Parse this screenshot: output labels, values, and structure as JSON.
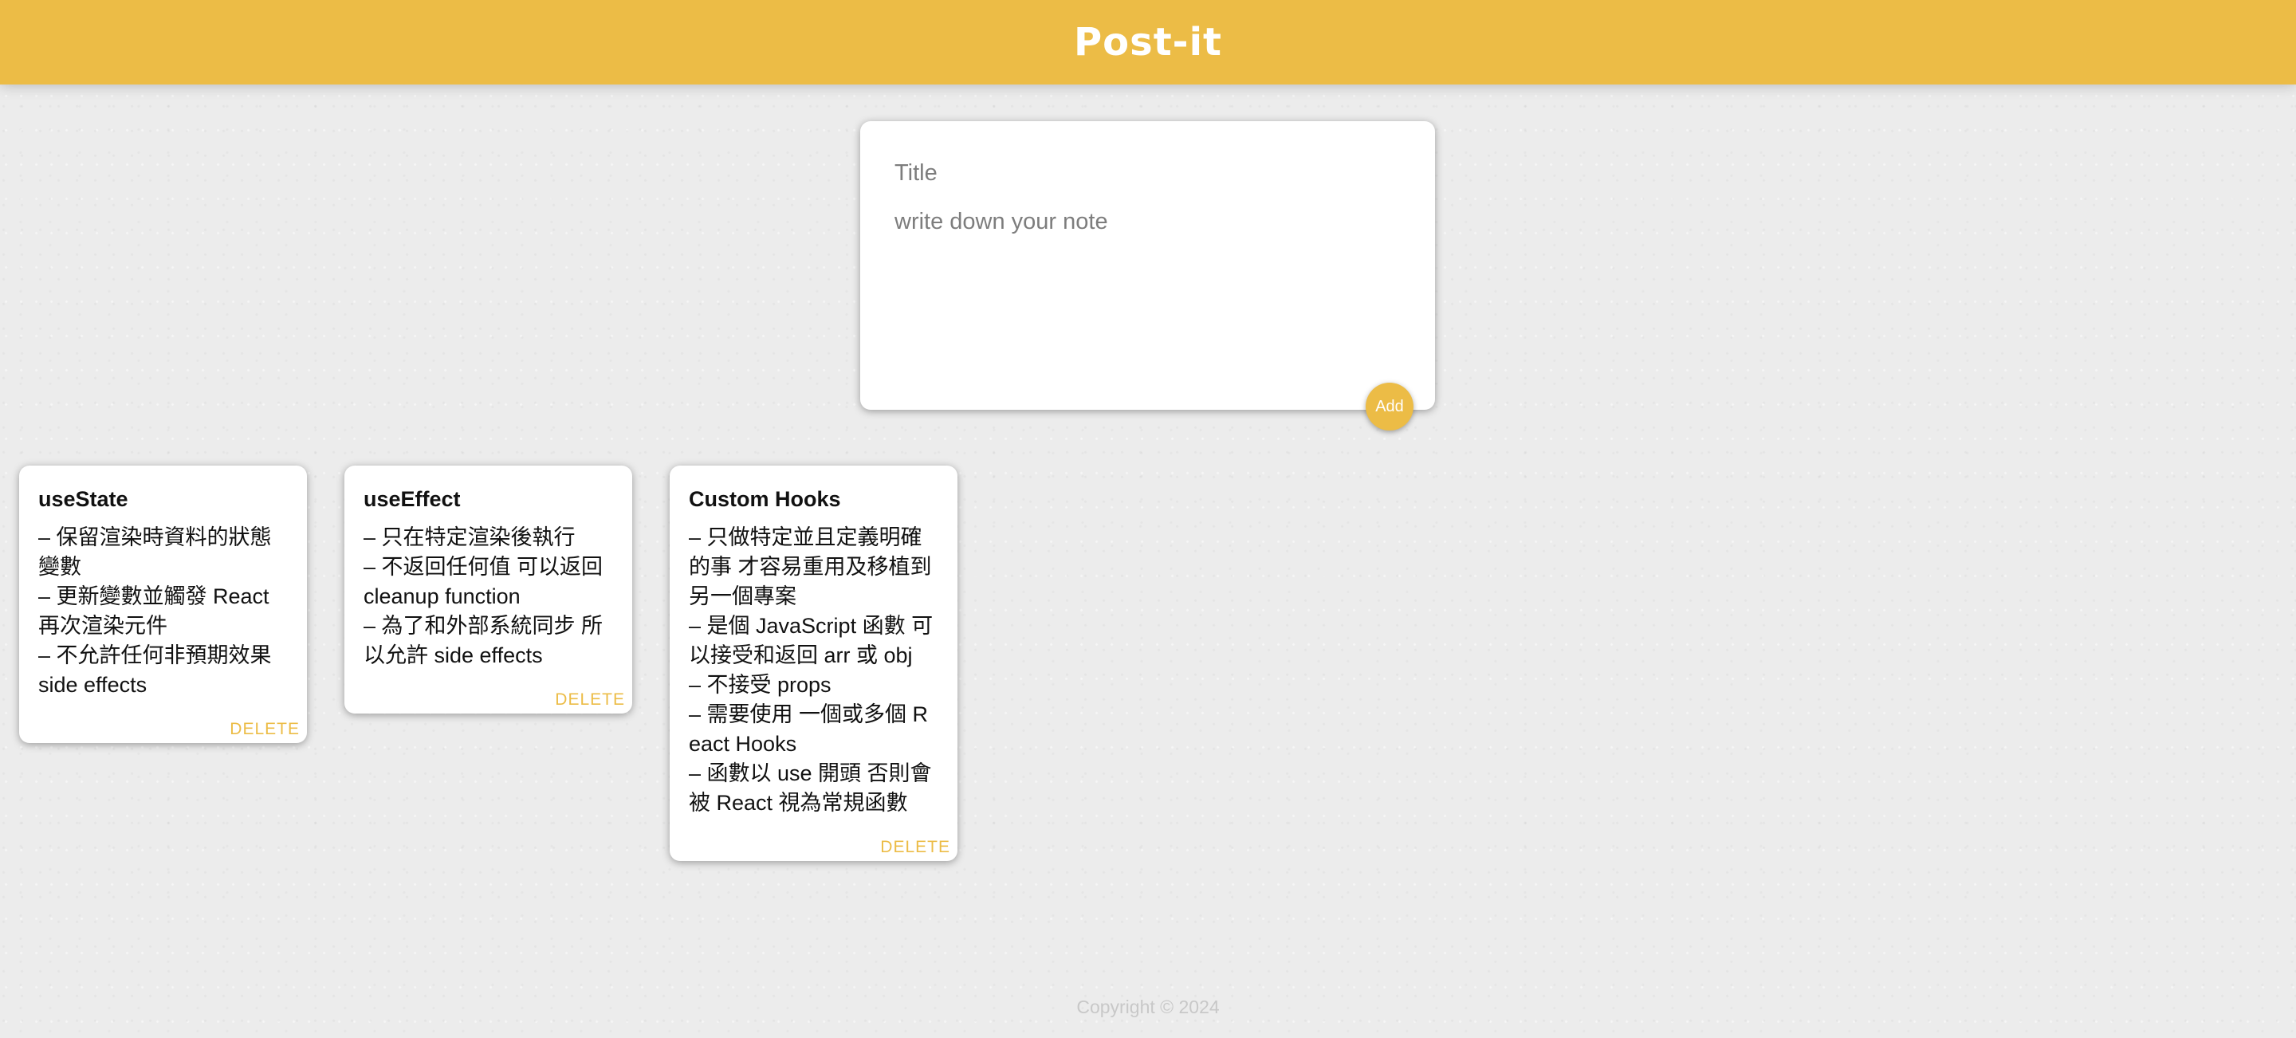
{
  "header": {
    "title": "Post-it",
    "accent_color": "#ecbc46"
  },
  "create_area": {
    "title_placeholder": "Title",
    "content_placeholder": "write down your note",
    "add_label": "Add"
  },
  "notes": [
    {
      "title": "useState",
      "content": "– 保留渲染時資料的狀態變數\n– 更新變數並觸發 React 再次渲染元件\n– 不允許任何非預期效果 side effects",
      "delete_label": "DELETE"
    },
    {
      "title": "useEffect",
      "content": "– 只在特定渲染後執行\n– 不返回任何值 可以返回 cleanup function\n– 為了和外部系統同步 所以允許 side effects",
      "delete_label": "DELETE"
    },
    {
      "title": "Custom Hooks",
      "content": "– 只做特定並且定義明確的事 才容易重用及移植到另一個專案\n– 是個 JavaScript 函數 可以接受和返回 arr 或 obj\n– 不接受 props\n– 需要使用 一個或多個 React Hooks\n– 函數以 use 開頭 否則會被 React 視為常規函數",
      "delete_label": "DELETE"
    }
  ],
  "footer": {
    "copyright": "Copyright © 2024"
  }
}
